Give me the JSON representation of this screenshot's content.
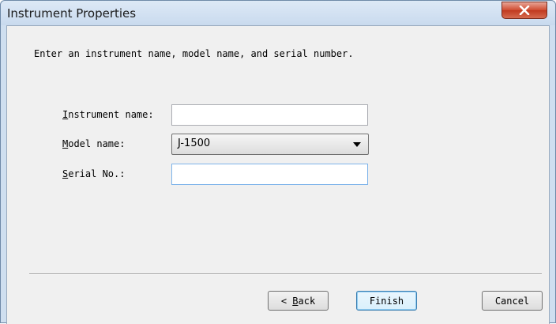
{
  "window": {
    "title": "Instrument Properties"
  },
  "instruction": "Enter an instrument name, model name, and serial number.",
  "fields": {
    "instrument_name": {
      "label_mnemonic": "I",
      "label_rest": "nstrument name:",
      "value": ""
    },
    "model_name": {
      "label_mnemonic": "M",
      "label_rest": "odel name:",
      "selected": "J-1500"
    },
    "serial_no": {
      "label_mnemonic": "S",
      "label_rest": "erial No.:",
      "value": ""
    }
  },
  "buttons": {
    "back_prefix": "< ",
    "back_mnemonic": "B",
    "back_rest": "ack",
    "finish": "Finish",
    "cancel": "Cancel"
  },
  "colors": {
    "close_button": "#c0391f",
    "client_background": "#f0f0f0",
    "default_button_border": "#3c7fb1"
  }
}
